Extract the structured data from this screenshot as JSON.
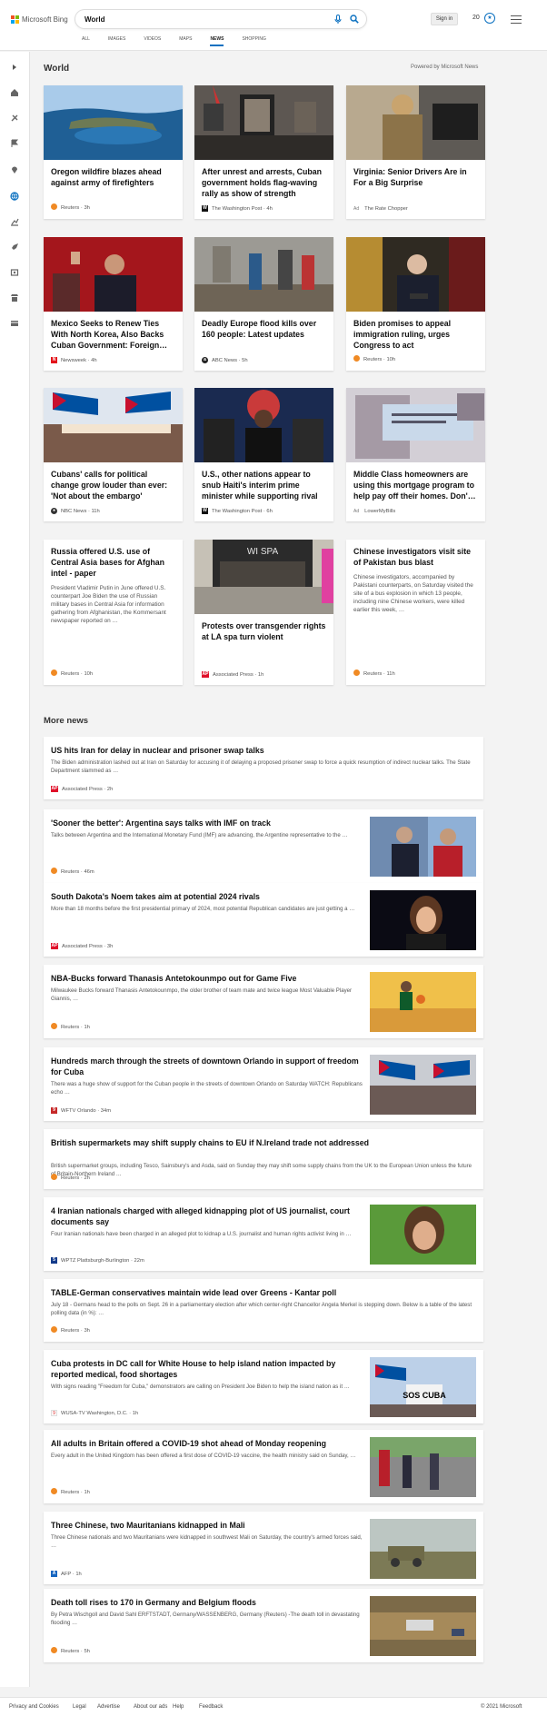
{
  "header": {
    "brand": "Microsoft Bing",
    "search_value": "World",
    "signin_label": "Sign in",
    "points": "20",
    "tabs": [
      {
        "label": "ALL"
      },
      {
        "label": "IMAGES"
      },
      {
        "label": "VIDEOS"
      },
      {
        "label": "MAPS"
      },
      {
        "label": "NEWS",
        "active": true
      },
      {
        "label": "SHOPPING"
      }
    ]
  },
  "rail_icons": [
    "arrow-right-icon",
    "home-icon",
    "flask-icon",
    "flag-icon",
    "pin-icon",
    "globe-icon",
    "chart-icon",
    "rocket-icon",
    "film-icon",
    "store-icon",
    "card-icon"
  ],
  "section_title": "World",
  "powered_by": "Powered by Microsoft News",
  "cards": [
    {
      "title": "Oregon wildfire blazes ahead against army of firefighters",
      "source": "Reuters · 3h",
      "logo": "reuters"
    },
    {
      "title": "After unrest and arrests, Cuban government holds flag-waving rally as show of strength",
      "source": "The Washington Post · 4h",
      "logo": "wapo"
    },
    {
      "title": "Virginia: Senior Drivers Are in For a Big Surprise",
      "source": "The Rate Chopper",
      "ad": "Ad",
      "logo": "none"
    },
    {
      "title": "Mexico Seeks to Renew Ties With North Korea, Also Backs Cuban Government: Foreign…",
      "source": "Newsweek · 4h",
      "logo": "newsweek"
    },
    {
      "title": "Deadly Europe flood kills over 160 people: Latest updates",
      "source": "ABC News · 5h",
      "logo": "abc"
    },
    {
      "title": "Biden promises to appeal immigration ruling, urges Congress to act",
      "source": "Reuters · 10h",
      "logo": "reuters"
    },
    {
      "title": "Cubans' calls for political change grow louder than ever: 'Not about the embargo'",
      "source": "NBC News · 11h",
      "logo": "nbc"
    },
    {
      "title": "U.S., other nations appear to snub Haiti's interim prime minister while supporting rival",
      "source": "The Washington Post · 6h",
      "logo": "wapo"
    },
    {
      "title": "Middle Class homeowners are using this mortgage program to help pay off their homes. Don'…",
      "source": "LowerMyBills",
      "ad": "Ad",
      "logo": "none"
    },
    {
      "title": "Russia offered U.S. use of Central Asia bases for Afghan intel - paper",
      "desc": "President Vladimir Putin in June offered U.S. counterpart Joe Biden the use of Russian military bases in Central Asia for information gathering from Afghanistan, the Kommersant newspaper reported on …",
      "source": "Reuters · 10h",
      "logo": "reuters"
    },
    {
      "title": "Protests over transgender rights at LA spa turn violent",
      "source": "Associated Press · 1h",
      "logo": "ap",
      "sign_text": "WI SPA"
    },
    {
      "title": "Chinese investigators visit site of Pakistan bus blast",
      "desc": "Chinese investigators, accompanied by Pakistani counterparts, on Saturday visited the site of a bus explosion in which 13 people, including nine Chinese workers, were killed earlier this week, …",
      "source": "Reuters · 11h",
      "logo": "reuters"
    }
  ],
  "more_news_title": "More news",
  "more_news": [
    {
      "title": "US hits Iran for delay in nuclear and prisoner swap talks",
      "desc": "The Biden administration lashed out at Iran on Saturday for accusing it of delaying a proposed prisoner swap to force a quick resumption of indirect nuclear talks. The State Department slammed as …",
      "source": "Associated Press · 2h",
      "logo": "ap"
    },
    {
      "title": "'Sooner the better': Argentina says talks with IMF on track",
      "desc": "Talks between Argentina and the International Monetary Fund (IMF) are advancing, the Argentine representative to the …",
      "source": "Reuters · 46m",
      "logo": "reuters"
    },
    {
      "title": "South Dakota's Noem takes aim at potential 2024 rivals",
      "desc": "More than 18 months before the first presidential primary of 2024, most potential Republican candidates are just getting a …",
      "source": "Associated Press · 3h",
      "logo": "ap"
    },
    {
      "title": "NBA-Bucks forward Thanasis Antetokounmpo out for Game Five",
      "desc": "Milwaukee Bucks forward Thanasis Antetokounmpo, the older brother of team mate and twice league Most Valuable Player Giannis, …",
      "source": "Reuters · 1h",
      "logo": "reuters"
    },
    {
      "title": "Hundreds march through the streets of downtown Orlando in support of freedom for Cuba",
      "desc": "There was a huge show of support for the Cuban people in the streets of downtown Orlando on Saturday WATCH: Republicans echo …",
      "source": "WFTV Orlando · 34m",
      "logo": "wftv"
    },
    {
      "title": "British supermarkets may shift supply chains to EU if N.Ireland trade not addressed",
      "desc": "British supermarket groups, including Tesco, Sainsbury's and Asda, said on Sunday they may shift some supply chains from the UK to the European Union unless the future of Britain-Northern Ireland …",
      "source": "Reuters · 2h",
      "logo": "reuters"
    },
    {
      "title": "4 Iranian nationals charged with alleged kidnapping plot of US journalist, court documents say",
      "desc": "Four Iranian nationals have been charged in an alleged plot to kidnap a U.S. journalist and human rights activist living in …",
      "source": "WPTZ Plattsburgh-Burlington · 22m",
      "logo": "wptz"
    },
    {
      "title": "TABLE-German conservatives maintain wide lead over Greens - Kantar poll",
      "desc": "July 18 - Germans head to the polls on Sept. 26 in a parliamentary election after which center-right Chancellor Angela Merkel is stepping down. Below is a table of the latest polling data (in %): …",
      "source": "Reuters · 3h",
      "logo": "reuters"
    },
    {
      "title": "Cuba protests in DC call for White House to help island nation impacted by reported medical, food shortages",
      "desc": "With signs reading \"Freedom for Cuba,\" demonstrators are calling on President Joe Biden to help the island nation as it …",
      "source": "WUSA-TV Washington, D.C. · 1h",
      "logo": "wusa",
      "sign_text": "SOS CUBA"
    },
    {
      "title": "All adults in Britain offered a COVID-19 shot ahead of Monday reopening",
      "desc": "Every adult in the United Kingdom has been offered a first dose of COVID-19 vaccine, the health ministry said on Sunday, …",
      "source": "Reuters · 1h",
      "logo": "reuters"
    },
    {
      "title": "Three Chinese, two Mauritanians kidnapped in Mali",
      "desc": "Three Chinese nationals and two Mauritanians were kidnapped in southwest Mali on Saturday, the country's armed forces said, …",
      "source": "AFP · 1h",
      "logo": "afp"
    },
    {
      "title": "Death toll rises to 170 in Germany and Belgium floods",
      "desc": "By Petra Wischgoll and David Sahl ERFTSTADT, Germany/WASSENBERG, Germany (Reuters) -The death toll in devastating flooding …",
      "source": "Reuters · 5h",
      "logo": "reuters"
    }
  ],
  "footer": {
    "links": [
      "Privacy and Cookies",
      "Legal",
      "Advertise",
      "About our ads",
      "Help",
      "Feedback"
    ],
    "copyright": "© 2021 Microsoft"
  },
  "colors": {
    "accent": "#0a70c0",
    "reuters": "#f08a24",
    "ap": "#e0102a",
    "newsweek": "#e3131a",
    "nbc": "#333333"
  }
}
